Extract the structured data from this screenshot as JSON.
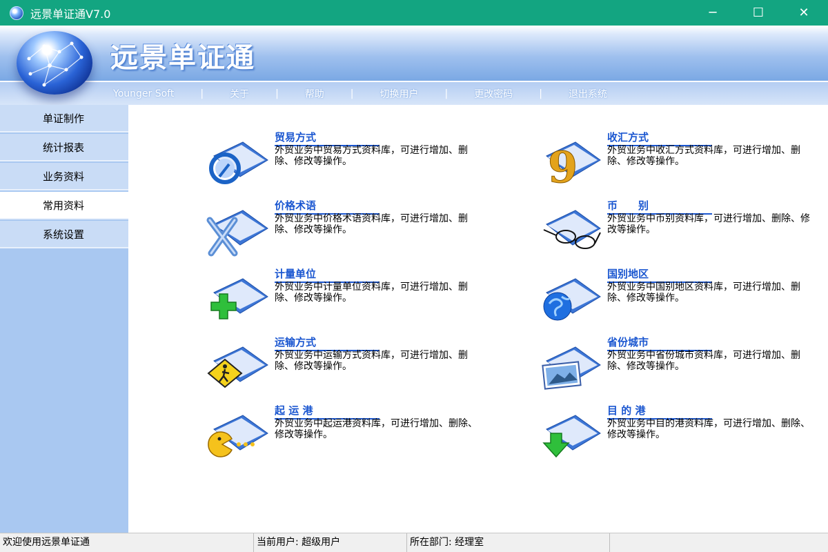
{
  "window": {
    "title": "远景单证通V7.0",
    "minimize_glyph": "─",
    "maximize_glyph": "☐",
    "close_glyph": "✕"
  },
  "header": {
    "brand": "远景单证通",
    "menu": [
      "Younger Soft",
      "关于",
      "帮助",
      "切换用户",
      "更改密码",
      "退出系统"
    ],
    "separator": "|"
  },
  "sidebar": {
    "items": [
      {
        "label": "单证制作",
        "active": false
      },
      {
        "label": "统计报表",
        "active": false
      },
      {
        "label": "业务资料",
        "active": false
      },
      {
        "label": "常用资料",
        "active": true
      },
      {
        "label": "系统设置",
        "active": false
      }
    ]
  },
  "cards": [
    {
      "title": "贸易方式",
      "desc": "外贸业务中贸易方式资料库，可进行增加、删除、修改等操作。",
      "icon": "magnifier-folder-icon"
    },
    {
      "title": "收汇方式",
      "desc": "外贸业务中收汇方式资料库，可进行增加、删除、修改等操作。",
      "icon": "nine-folder-icon"
    },
    {
      "title": "价格术语",
      "desc": "外贸业务中价格术语资料库，可进行增加、删除、修改等操作。",
      "icon": "x-folder-icon"
    },
    {
      "title": "币　　别",
      "desc": "外贸业务中币别资料库，可进行增加、删除、修改等操作。",
      "icon": "glasses-folder-icon"
    },
    {
      "title": "计量单位",
      "desc": "外贸业务中计量单位资料库，可进行增加、删除、修改等操作。",
      "icon": "plus-folder-icon"
    },
    {
      "title": "国别地区",
      "desc": "外贸业务中国别地区资料库，可进行增加、删除、修改等操作。",
      "icon": "globe-folder-icon"
    },
    {
      "title": "运输方式",
      "desc": "外贸业务中运输方式资料库，可进行增加、删除、修改等操作。",
      "icon": "sign-folder-icon"
    },
    {
      "title": "省份城市",
      "desc": "外贸业务中省份城市资料库，可进行增加、删除、修改等操作。",
      "icon": "picture-folder-icon"
    },
    {
      "title": "起 运 港",
      "desc": "外贸业务中起运港资料库，可进行增加、删除、修改等操作。",
      "icon": "pacman-folder-icon"
    },
    {
      "title": "目 的 港",
      "desc": "外贸业务中目的港资料库，可进行增加、删除、修改等操作。",
      "icon": "down-arrow-folder-icon"
    }
  ],
  "status": {
    "welcome": "欢迎使用远景单证通",
    "current_user": "当前用户: 超级用户",
    "department": "所在部门: 经理室"
  }
}
